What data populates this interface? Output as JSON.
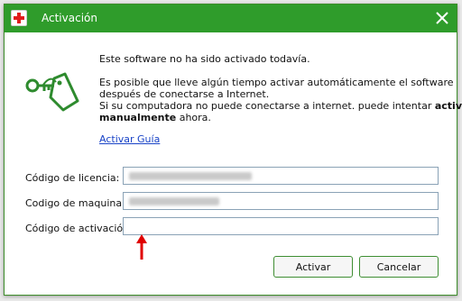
{
  "window": {
    "title": "Activación"
  },
  "content": {
    "line1": "Este software no ha sido activado todavía.",
    "para_line1": "Es posible que lleve algún tiempo activar automáticamente el software",
    "para_line2": "después de conectarse a Internet.",
    "para_line3_pre": "Si su computadora no puede conectarse a internet. puede intentar ",
    "para_line3_bold": "activar",
    "para_line4_bold": "manualmente",
    "para_line4_post": " ahora.",
    "link": "Activar Guía"
  },
  "form": {
    "license_label": "Código de licencia:",
    "machine_label": "Codigo de maquina:",
    "activation_label": "Código de activación:",
    "activation_value": ""
  },
  "buttons": {
    "activate": "Activar",
    "cancel": "Cancelar"
  },
  "icons": {
    "app": "first-aid-icon",
    "close": "close-icon",
    "key": "key-tag-icon",
    "arrow": "arrow-up-icon"
  },
  "colors": {
    "titlebar": "#2f9c2b",
    "icon_green": "#2e8b2e",
    "arrow": "#e00000",
    "link": "#1a44c7"
  }
}
